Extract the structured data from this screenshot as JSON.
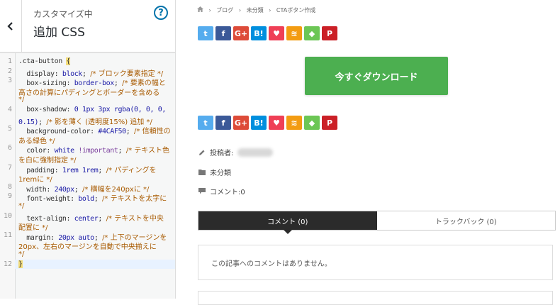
{
  "customizer": {
    "subtitle": "カスタマイズ中",
    "title": "追加 CSS",
    "help_glyph": "?",
    "code_lines": [
      {
        "n": "1",
        "segs": [
          [
            "sel",
            ".cta-button "
          ],
          [
            "brace",
            "{"
          ]
        ]
      },
      {
        "n": "2",
        "segs": [
          [
            "prop",
            "  display: "
          ],
          [
            "val",
            "block"
          ],
          [
            "prop",
            "; "
          ],
          [
            "cmt",
            "/* ブロック要素指定 */"
          ]
        ]
      },
      {
        "n": "3",
        "segs": [
          [
            "prop",
            "  box-sizing: "
          ],
          [
            "val",
            "border-box"
          ],
          [
            "prop",
            "; "
          ],
          [
            "cmt",
            "/* 要素の幅と"
          ]
        ]
      },
      {
        "n": "",
        "segs": [
          [
            "cmt",
            "高さの計算にパディングとボーダーを含める"
          ]
        ]
      },
      {
        "n": "",
        "segs": [
          [
            "cmt",
            "*/"
          ]
        ]
      },
      {
        "n": "4",
        "segs": [
          [
            "prop",
            "  box-shadow: "
          ],
          [
            "val",
            "0 1px 3px rgba(0, 0, 0,"
          ]
        ]
      },
      {
        "n": "",
        "segs": [
          [
            "val",
            "0.15)"
          ],
          [
            "prop",
            "; "
          ],
          [
            "cmt",
            "/* 影を薄く (透明度15%) 追加 */"
          ]
        ]
      },
      {
        "n": "5",
        "segs": [
          [
            "prop",
            "  background-color: "
          ],
          [
            "val",
            "#4CAF50"
          ],
          [
            "prop",
            "; "
          ],
          [
            "cmt",
            "/* 信頼性の"
          ]
        ]
      },
      {
        "n": "",
        "segs": [
          [
            "cmt",
            "ある緑色 */"
          ]
        ]
      },
      {
        "n": "6",
        "segs": [
          [
            "prop",
            "  color: "
          ],
          [
            "val",
            "white "
          ],
          [
            "imp",
            "!important"
          ],
          [
            "prop",
            "; "
          ],
          [
            "cmt",
            "/* テキスト色"
          ]
        ]
      },
      {
        "n": "",
        "segs": [
          [
            "cmt",
            "を白に強制指定 */"
          ]
        ]
      },
      {
        "n": "7",
        "segs": [
          [
            "prop",
            "  padding: "
          ],
          [
            "val",
            "1rem 1rem"
          ],
          [
            "prop",
            "; "
          ],
          [
            "cmt",
            "/* パディングを"
          ]
        ]
      },
      {
        "n": "",
        "segs": [
          [
            "cmt",
            "1remに */"
          ]
        ]
      },
      {
        "n": "8",
        "segs": [
          [
            "prop",
            "  width: "
          ],
          [
            "val",
            "240px"
          ],
          [
            "prop",
            "; "
          ],
          [
            "cmt",
            "/* 横幅を240pxに */"
          ]
        ]
      },
      {
        "n": "9",
        "segs": [
          [
            "prop",
            "  font-weight: "
          ],
          [
            "val",
            "bold"
          ],
          [
            "prop",
            "; "
          ],
          [
            "cmt",
            "/* テキストを太字に"
          ]
        ]
      },
      {
        "n": "",
        "segs": [
          [
            "cmt",
            "*/"
          ]
        ]
      },
      {
        "n": "10",
        "segs": [
          [
            "prop",
            "  text-align: "
          ],
          [
            "val",
            "center"
          ],
          [
            "prop",
            "; "
          ],
          [
            "cmt",
            "/* テキストを中央"
          ]
        ]
      },
      {
        "n": "",
        "segs": [
          [
            "cmt",
            "配置に */"
          ]
        ]
      },
      {
        "n": "11",
        "segs": [
          [
            "prop",
            "  margin: "
          ],
          [
            "val",
            "20px auto"
          ],
          [
            "prop",
            "; "
          ],
          [
            "cmt",
            "/* 上下のマージンを"
          ]
        ]
      },
      {
        "n": "",
        "segs": [
          [
            "cmt",
            "20px、左右のマージンを自動で中央揃えに"
          ]
        ]
      },
      {
        "n": "",
        "segs": [
          [
            "cmt",
            "*/"
          ]
        ]
      },
      {
        "n": "12",
        "segs": [
          [
            "brace",
            "}"
          ]
        ]
      }
    ]
  },
  "preview": {
    "breadcrumbs": [
      "ブログ",
      "未分類",
      "CTAボタン作成"
    ],
    "share_buttons": [
      {
        "name": "twitter",
        "glyph": "t",
        "color": "#55acee"
      },
      {
        "name": "facebook",
        "glyph": "f",
        "color": "#3b5998"
      },
      {
        "name": "google",
        "glyph": "G+",
        "color": "#dd4b39"
      },
      {
        "name": "hatena",
        "glyph": "B!",
        "color": "#008fde"
      },
      {
        "name": "pocket",
        "glyph": "♥",
        "color": "#ef3f56"
      },
      {
        "name": "rss",
        "glyph": "≋",
        "color": "#f39c12"
      },
      {
        "name": "feedly",
        "glyph": "◆",
        "color": "#6cc655"
      },
      {
        "name": "pinterest",
        "glyph": "P",
        "color": "#cb2027"
      }
    ],
    "cta_label": "今すぐダウンロード",
    "cta_color": "#4CAF50",
    "meta": {
      "author_label": "投稿者:",
      "category": "未分類",
      "comment_count": "コメント:0"
    },
    "tabs": {
      "comments": "コメント (0)",
      "trackbacks": "トラックバック (0)"
    },
    "no_comments": "この記事へのコメントはありません。"
  }
}
